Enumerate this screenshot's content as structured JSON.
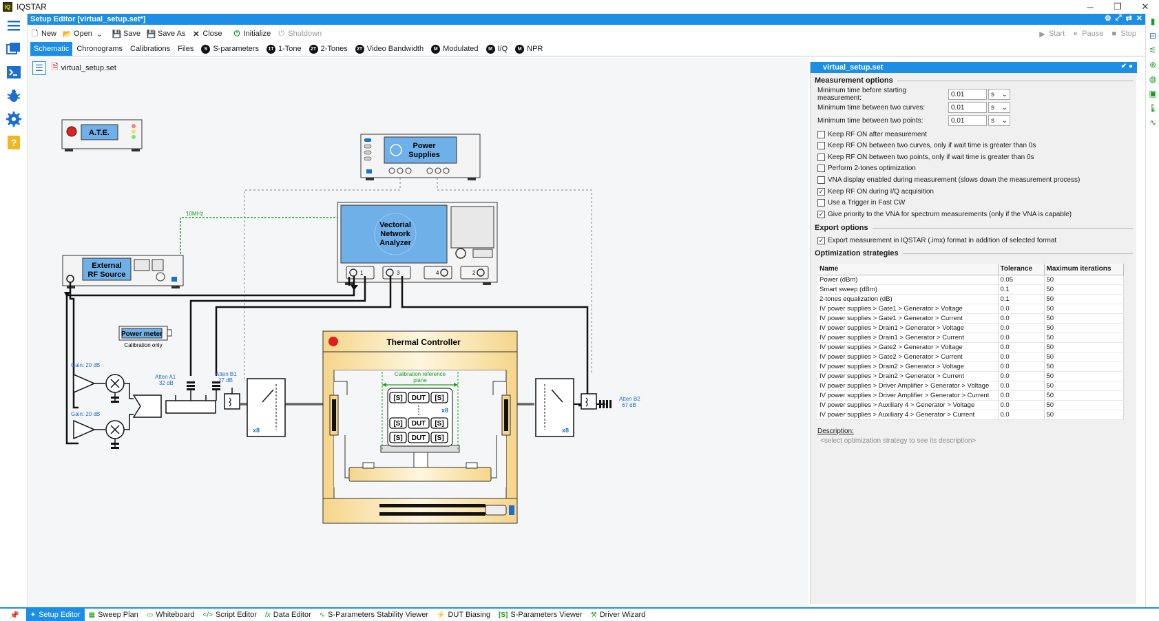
{
  "app": {
    "title": "IQSTAR"
  },
  "window_controls": {
    "minimize": "─",
    "restore": "❐",
    "close": "✕"
  },
  "editor": {
    "title": "Setup Editor [virtual_setup.set*]",
    "header_icons": [
      "⚙",
      "⤢",
      "⇄",
      "✕"
    ]
  },
  "toolbar": {
    "new": "New",
    "open": "Open",
    "save": "Save",
    "save_as": "Save As",
    "close": "Close",
    "initialize": "Initialize",
    "shutdown": "Shutdown",
    "start": "Start",
    "pause": "Pause",
    "stop": "Stop"
  },
  "tabs": [
    {
      "label": "Schematic",
      "badge": ""
    },
    {
      "label": "Chronograms",
      "badge": ""
    },
    {
      "label": "Calibrations",
      "badge": ""
    },
    {
      "label": "Files",
      "badge": ""
    },
    {
      "label": "S-parameters",
      "badge": "S"
    },
    {
      "label": "1-Tone",
      "badge": "1T"
    },
    {
      "label": "2-Tones",
      "badge": "2T"
    },
    {
      "label": "Video Bandwidth",
      "badge": "2T"
    },
    {
      "label": "Modulated",
      "badge": "M"
    },
    {
      "label": "I/Q",
      "badge": "M"
    },
    {
      "label": "NPR",
      "badge": "M"
    }
  ],
  "canvas": {
    "filename": "virtual_setup.set",
    "ate_label": "A.T.E.",
    "power_supplies": "Power Supplies",
    "power_supplies_l1": "Power",
    "power_supplies_l2": "Supplies",
    "vna_l1": "Vectorial",
    "vna_l2": "Network",
    "vna_l3": "Analyzer",
    "ext_rf_l1": "External",
    "ext_rf_l2": "RF Source",
    "ref_clock": "10MHz",
    "power_meter": "Power meter",
    "power_meter_note": "Calibration only",
    "thermal_controller": "Thermal Controller",
    "cal_ref_l1": "Calibration reference",
    "cal_ref_l2": "plane",
    "gain1": "Gain: 20 dB",
    "gain2": "Gain: 20 dB",
    "atten_a1_l1": "Atten A1",
    "atten_a1_l2": "32 dB",
    "atten_b1_l1": "Atten B1",
    "atten_b1_l2": "27 dB",
    "atten_b2_l1": "Atten B2",
    "atten_b2_l2": "67 dB",
    "mult_left": "x8",
    "mult_dut": "x8",
    "mult_right": "x8",
    "s_block": "[S]",
    "dut": "DUT",
    "vna_ports": [
      "1",
      "3",
      "4",
      "2"
    ]
  },
  "panel": {
    "title": "virtual_setup.set",
    "measurement_options": "Measurement options",
    "timing": [
      {
        "label": "Minimum time before starting measurement:",
        "value": "0.01",
        "unit": "s"
      },
      {
        "label": "Minimum time between two curves:",
        "value": "0.01",
        "unit": "s"
      },
      {
        "label": "Minimum time between two points:",
        "value": "0.01",
        "unit": "s"
      }
    ],
    "checkboxes": [
      {
        "label": "Keep RF ON after measurement",
        "checked": false
      },
      {
        "label": "Keep RF ON between two curves, only if wait time is greater than 0s",
        "checked": false
      },
      {
        "label": "Keep RF ON between two points, only if wait time is greater than 0s",
        "checked": false
      },
      {
        "label": "Perform 2-tones optimization",
        "checked": false
      },
      {
        "label": "VNA display enabled during measurement (slows down the measurement process)",
        "checked": false
      },
      {
        "label": "Keep RF ON during I/Q acquisition",
        "checked": true
      },
      {
        "label": "Use a Trigger in Fast CW",
        "checked": false
      },
      {
        "label": "Give priority to the VNA for spectrum measurements (only if the VNA is capable)",
        "checked": true
      }
    ],
    "export_options": "Export options",
    "export_checkbox": {
      "label": "Export measurement in IQSTAR (.imx) format in addition of selected format",
      "checked": true
    },
    "optimization": "Optimization strategies",
    "table_headers": [
      "Name",
      "Tolerance",
      "Maximum iterations"
    ],
    "table_rows": [
      [
        "Power (dBm)",
        "0.05",
        "50"
      ],
      [
        "Smart sweep (dBm)",
        "0.1",
        "50"
      ],
      [
        "2-tones equalization (dB)",
        "0.1",
        "50"
      ],
      [
        "IV power supplies > Gate1 > Generator > Voltage",
        "0.0",
        "50"
      ],
      [
        "IV power supplies > Gate1 > Generator > Current",
        "0.0",
        "50"
      ],
      [
        "IV power supplies > Drain1 > Generator > Voltage",
        "0.0",
        "50"
      ],
      [
        "IV power supplies > Drain1 > Generator > Current",
        "0.0",
        "50"
      ],
      [
        "IV power supplies > Gate2 > Generator > Voltage",
        "0.0",
        "50"
      ],
      [
        "IV power supplies > Gate2 > Generator > Current",
        "0.0",
        "50"
      ],
      [
        "IV power supplies > Drain2 > Generator > Voltage",
        "0.0",
        "50"
      ],
      [
        "IV power supplies > Drain2 > Generator > Current",
        "0.0",
        "50"
      ],
      [
        "IV power supplies > Driver Amplifier > Generator > Voltage",
        "0.0",
        "50"
      ],
      [
        "IV power supplies > Driver Amplifier > Generator > Current",
        "0.0",
        "50"
      ],
      [
        "IV power supplies > Auxiliary 4 > Generator > Voltage",
        "0.0",
        "50"
      ],
      [
        "IV power supplies > Auxiliary 4 > Generator > Current",
        "0.0",
        "50"
      ]
    ],
    "description_label": "Description:",
    "description_placeholder": "<select optimization strategy to see its description>"
  },
  "bottom_tabs": [
    {
      "label": "Setup Editor",
      "icon": "✦",
      "active": true
    },
    {
      "label": "Sweep Plan",
      "icon": "▦",
      "active": false
    },
    {
      "label": "Whiteboard",
      "icon": "▭",
      "active": false
    },
    {
      "label": "Script Editor",
      "icon": "</>",
      "active": false
    },
    {
      "label": "Data Editor",
      "icon": "fx",
      "active": false
    },
    {
      "label": "S-Parameters Stability Viewer",
      "icon": "∿",
      "active": false
    },
    {
      "label": "DUT Biasing",
      "icon": "⚡",
      "active": false
    },
    {
      "label": "S-Parameters Viewer",
      "icon": "[S]",
      "active": false
    },
    {
      "label": "Driver Wizard",
      "icon": "⚒",
      "active": false
    }
  ],
  "colors": {
    "accent": "#1c8ee6",
    "screen_blue": "#5aa8e6",
    "thermal_gold": "#f5d58a",
    "ref_green": "#22a022",
    "label_blue": "#1c6fd0"
  }
}
